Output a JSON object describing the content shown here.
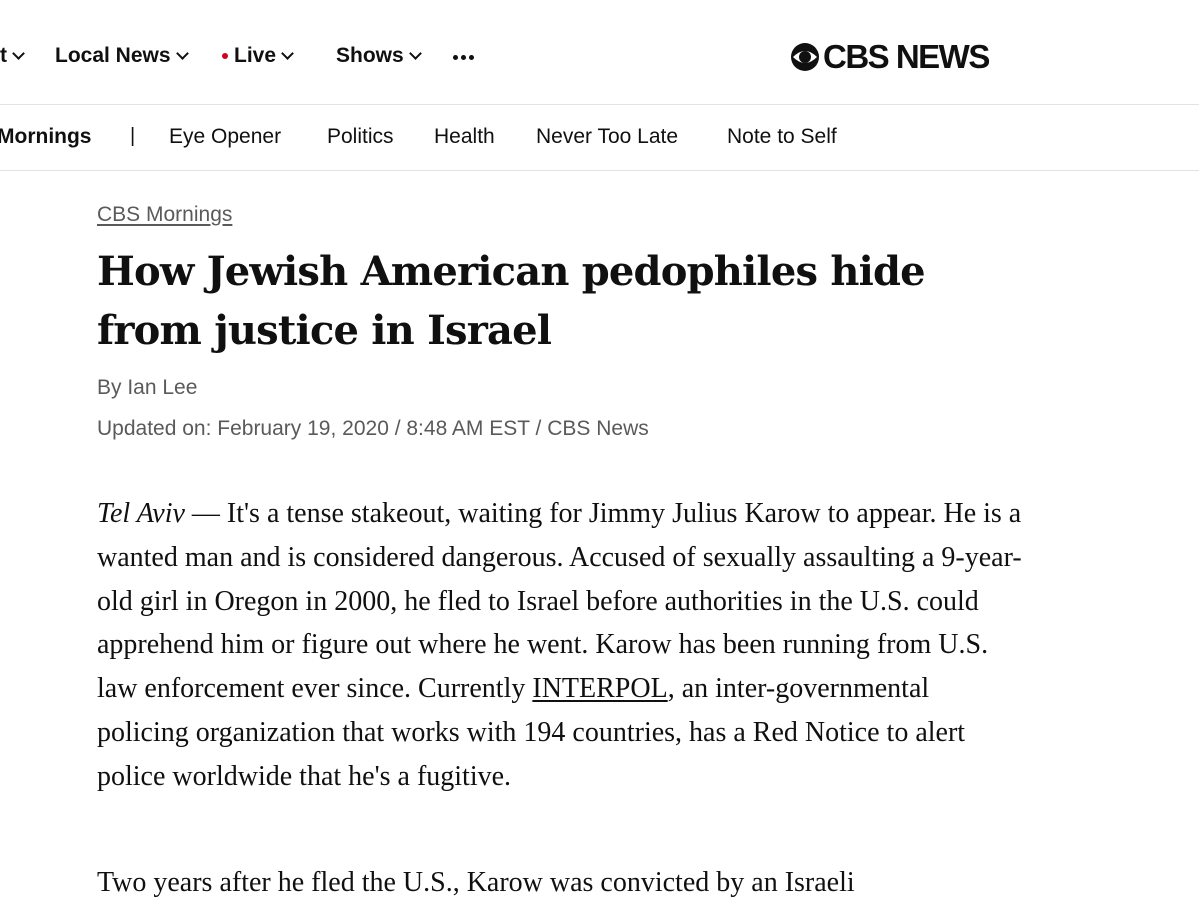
{
  "top_nav": {
    "partial_item": "t",
    "items": [
      {
        "label": "Local News"
      },
      {
        "label": "Live"
      },
      {
        "label": "Shows"
      }
    ],
    "live_dot_color": "#d0021b",
    "logo_text": "CBS NEWS"
  },
  "sub_nav": {
    "active": "Mornings",
    "separator": "|",
    "items": [
      "Eye Opener",
      "Politics",
      "Health",
      "Never Too Late",
      "Note to Self"
    ]
  },
  "article": {
    "section": "CBS Mornings",
    "title": "How Jewish American pedophiles hide from justice in Israel",
    "byline": "By Ian Lee",
    "updated": "Updated on: February 19, 2020 / 8:48 AM EST / CBS News",
    "paragraph1": {
      "place": "Tel Aviv",
      "dash": " — ",
      "text_before_link": "It's a tense stakeout, waiting for Jimmy Julius Karow to appear. He is a wanted man and is considered dangerous. Accused of sexually assaulting a 9-year-old girl in Oregon in 2000, he fled to Israel before authorities in the U.S. could apprehend him or figure out where he went. Karow has been running from U.S. law enforcement ever since. Currently ",
      "link_text": "INTERPOL",
      "text_after_link": ", an inter-governmental policing organization that works with 194 countries, has a Red Notice to alert police worldwide that he's a fugitive."
    },
    "paragraph2": "Two years after he fled the U.S., Karow was convicted by an Israeli"
  }
}
